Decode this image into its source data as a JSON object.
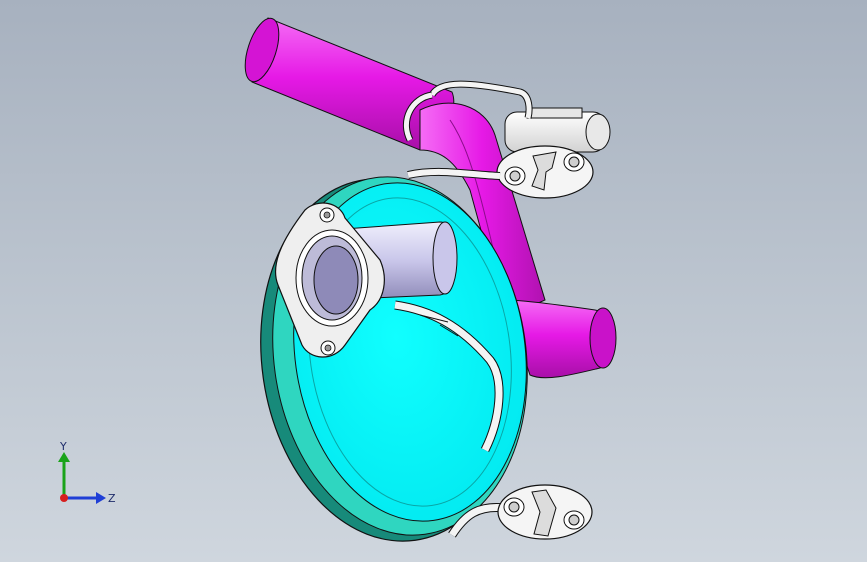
{
  "viewport": {
    "background_top": "#a7b1bf",
    "background_bottom": "#cfd6de"
  },
  "model": {
    "colors": {
      "intake_pipe": "#e619e6",
      "intake_pipe_shade": "#a80fa8",
      "muffler_face": "#00ffff",
      "muffler_rim": "#2fd6c0",
      "muffler_rim_dark": "#178a7a",
      "tailpipe": "#d8d6f2",
      "tailpipe_shade": "#8e8ab8",
      "flange": "#efefef",
      "hanger_rubber": "#f4f4f4",
      "outline": "#111111"
    }
  },
  "triad": {
    "y_label": "Y",
    "z_label": "Z",
    "y_color": "#1aa31a",
    "z_color": "#1f3fd6",
    "x_color": "#d61f1f"
  }
}
